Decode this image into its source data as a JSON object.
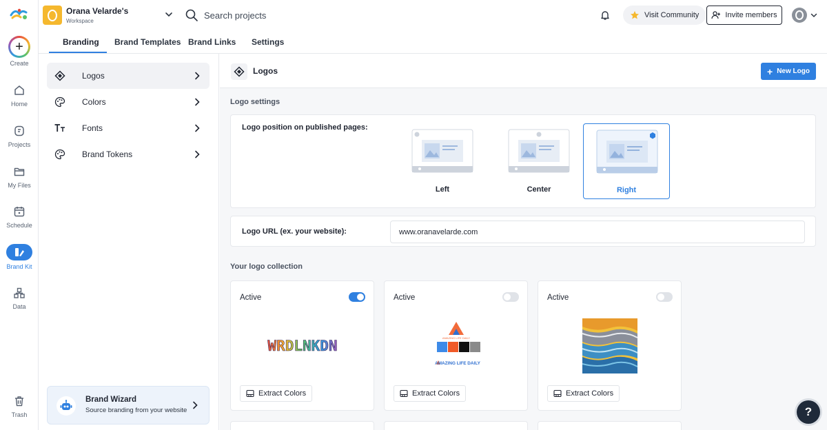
{
  "nav": {
    "items": [
      {
        "label": "Create",
        "icon": "plus-icon"
      },
      {
        "label": "Home",
        "icon": "home-icon"
      },
      {
        "label": "Projects",
        "icon": "projects-icon"
      },
      {
        "label": "My Files",
        "icon": "folder-icon"
      },
      {
        "label": "Schedule",
        "icon": "calendar-icon"
      },
      {
        "label": "Brand Kit",
        "icon": "brand-kit-icon"
      },
      {
        "label": "Data",
        "icon": "data-icon"
      }
    ],
    "trash_label": "Trash"
  },
  "header": {
    "workspace_name": "Orana Velarde's",
    "workspace_sub": "Workspace",
    "search_placeholder": "Search projects",
    "visit_community": "Visit Community",
    "invite_members": "Invite members"
  },
  "tabs": [
    "Branding",
    "Brand Templates",
    "Brand Links",
    "Settings"
  ],
  "sidebar": {
    "items": [
      {
        "label": "Logos",
        "icon": "logo-diamond-icon",
        "active": true
      },
      {
        "label": "Colors",
        "icon": "palette-icon"
      },
      {
        "label": "Fonts",
        "icon": "fonts-icon"
      },
      {
        "label": "Brand Tokens",
        "icon": "palette-icon"
      }
    ],
    "wizard": {
      "title": "Brand Wizard",
      "subtitle": "Source branding from your website"
    }
  },
  "main": {
    "title": "Logos",
    "new_logo_label": "New Logo",
    "logo_settings_label": "Logo settings",
    "position_label": "Logo position on published pages:",
    "position_options": [
      "Left",
      "Center",
      "Right"
    ],
    "selected_position": "Right",
    "url_label": "Logo URL (ex. your website):",
    "url_value": "www.oranavelarde.com",
    "collection_label": "Your logo collection",
    "logos": [
      {
        "status": "Active",
        "enabled": true,
        "extract_label": "Extract Colors",
        "wordmark": "WRDLNKDN"
      },
      {
        "status": "Active",
        "enabled": false,
        "extract_label": "Extract Colors",
        "top_text": "AMAZING LIFE DAILY",
        "bottom_text": "AMAZING LIFE DAILY"
      },
      {
        "status": "Active",
        "enabled": false,
        "extract_label": "Extract Colors"
      }
    ]
  },
  "help_label": "?",
  "colors": {
    "accent": "#2f80e0",
    "toggle_off": "#e0e3e8",
    "help_bg": "#1f2a3a"
  }
}
